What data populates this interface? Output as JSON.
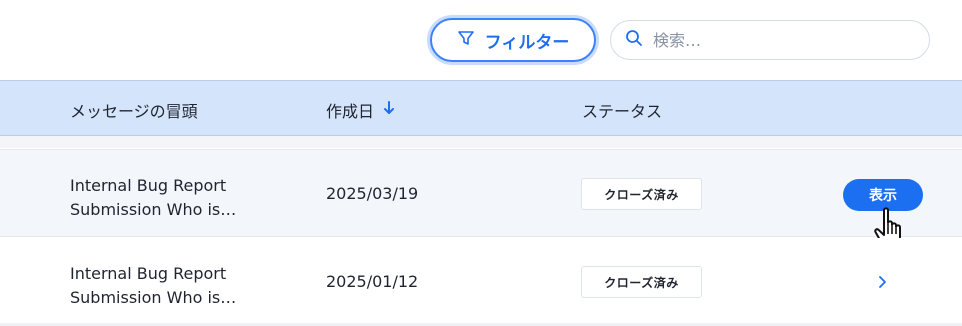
{
  "toolbar": {
    "filter_label": "フィルター",
    "search_placeholder": "検索…"
  },
  "table": {
    "headers": {
      "message": "メッセージの冒頭",
      "created": "作成日",
      "status": "ステータス"
    },
    "rows": [
      {
        "message_line1": "Internal Bug Report",
        "message_line2": "Submission Who is…",
        "date": "2025/03/19",
        "status": "クローズ済み",
        "action_label": "表示"
      },
      {
        "message_line1": "Internal Bug Report",
        "message_line2": "Submission Who is…",
        "date": "2025/01/12",
        "status": "クローズ済み"
      }
    ]
  },
  "icons": {
    "filter": "funnel-icon",
    "search": "search-icon",
    "sort": "arrow-down-icon",
    "row_chevron": "chevron-right-icon",
    "pointer": "hand-pointer-cursor"
  },
  "colors": {
    "accent": "#1d6ff2",
    "header_bg": "#d4e4fb",
    "hover_row_bg": "#f3f6fa"
  }
}
